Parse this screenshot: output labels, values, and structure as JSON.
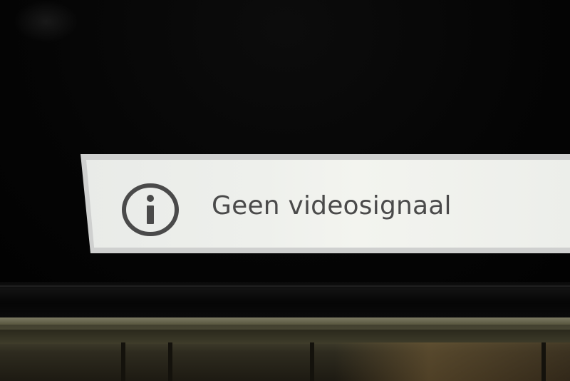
{
  "notification": {
    "message": "Geen videosignaal",
    "icon": "info-icon"
  },
  "colors": {
    "screen_background": "#050505",
    "banner_background": "#eceeea",
    "banner_border": "#cfd0cf",
    "text_color": "#4a4a4a",
    "icon_color": "#4a4a4a"
  }
}
